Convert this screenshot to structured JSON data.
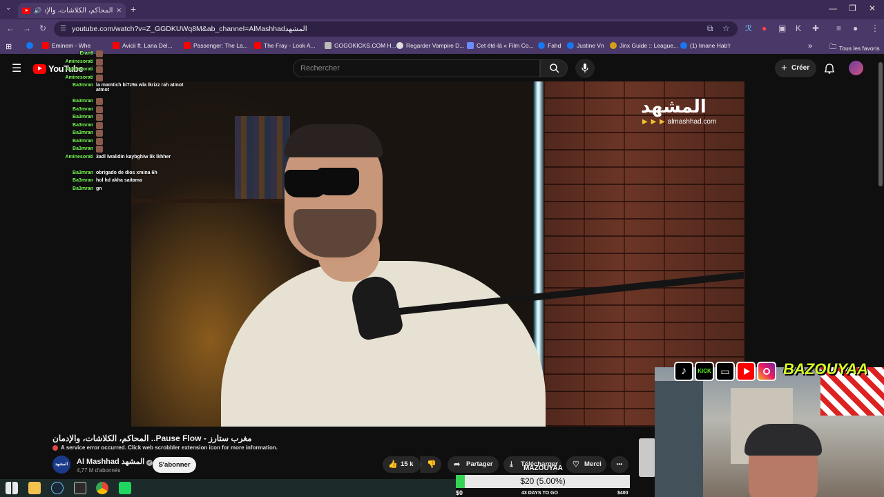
{
  "browser": {
    "tab_title": "المحاكم، الكلاشات، والإدمان",
    "url": "youtube.com/watch?v=Z_GGDKUWq8M&ab_channel=AlMashhad",
    "url_suffix": "المشهد",
    "new_tab": "+",
    "window_minimize": "—",
    "window_restore": "❐",
    "window_close": "✕"
  },
  "bookmarks": [
    {
      "label": "Eminem - Whe",
      "color": "#ff0000"
    },
    {
      "label": "Avicii ft. Lana Del...",
      "color": "#ff0000"
    },
    {
      "label": "Passenger: The La...",
      "color": "#ff0000"
    },
    {
      "label": "The Fray - Look A...",
      "color": "#ff0000"
    },
    {
      "label": "GOGOKICKS.COM H...",
      "color": "#cccccc"
    },
    {
      "label": "Regarder Vampire D...",
      "color": "#cccccc"
    },
    {
      "label": "Cet été-là « Film Co...",
      "color": "#6a8cff"
    },
    {
      "label": "Fahd",
      "color": "#1877f2"
    },
    {
      "label": "Justine Vn",
      "color": "#1877f2"
    },
    {
      "label": "Jinx Guide :: League...",
      "color": "#d4a017"
    },
    {
      "label": "(1) Imane Hab'r",
      "color": "#1877f2"
    }
  ],
  "bookmarks_all": "Tous les favoris",
  "youtube": {
    "logo": "YouTube",
    "search_placeholder": "Rechercher",
    "create_label": "Créer",
    "notifications_icon": "bell-icon"
  },
  "video": {
    "watermark_ar": "المشهد",
    "watermark_site": "almashhad.com",
    "watermark_arrows": "▶ ▶ ▶",
    "title_ar": "مغرب ستارز - Pause Flow.. المحاكم، الكلاشات، والإدمان",
    "error_text": "A service error occurred. Click web scrobbler extension icon for more information."
  },
  "channel": {
    "name": "Al Mashhad المشهد",
    "subscribers": "4,77 M d'abonnés",
    "avatar_text": "المشهد",
    "subscribe_label": "S'abonner"
  },
  "actions": {
    "likes": "15 k",
    "share": "Partager",
    "download": "Télécharger",
    "thanks": "Merci",
    "more": "•••"
  },
  "chat": [
    {
      "user": "Eran9",
      "msg": "",
      "emote": true
    },
    {
      "user": "Aminesorati",
      "msg": "",
      "emote": true
    },
    {
      "user": "Aminesorati",
      "msg": "",
      "emote": true
    },
    {
      "user": "Aminesorati",
      "msg": "",
      "emote": true
    },
    {
      "user": "Ba3mran",
      "msg": "la mamtich bl7z9a wla lkrizz rah atmot atmot",
      "emote": false
    },
    {
      "user": "Ba3mran",
      "msg": "",
      "emote": true
    },
    {
      "user": "Ba3mran",
      "msg": "",
      "emote": true
    },
    {
      "user": "Ba3mran",
      "msg": "",
      "emote": true
    },
    {
      "user": "Ba3mran",
      "msg": "",
      "emote": true
    },
    {
      "user": "Ba3mran",
      "msg": "",
      "emote": true
    },
    {
      "user": "Ba3mran",
      "msg": "",
      "emote": true
    },
    {
      "user": "Ba3mran",
      "msg": "",
      "emote": true
    },
    {
      "user": "Aminesorati",
      "msg": "3adl lwalidin kaybghiw lik lkhher",
      "emote": false
    },
    {
      "user": "Ba3mran",
      "msg": "obrigado de dios xmina 6h",
      "emote": false
    },
    {
      "user": "Ba3mran",
      "msg": "hol hd akha saitama",
      "emote": false
    },
    {
      "user": "Ba3mran",
      "msg": "gn",
      "emote": false
    }
  ],
  "overlay": {
    "streamer": "BAZOUYAA",
    "goal_name": "MAZOUYAA",
    "goal_amount": "$20 (5.00%)",
    "goal_progress": 0.05,
    "goal_min": "$0",
    "goal_days": "43 DAYS TO GO",
    "goal_max": "$400",
    "kick_label": "KICK"
  },
  "colors": {
    "chat_user": "#7cfc5a",
    "goal_fill": "#35d455",
    "youtube_red": "#ff0000",
    "browser_frame": "#4a3868"
  }
}
